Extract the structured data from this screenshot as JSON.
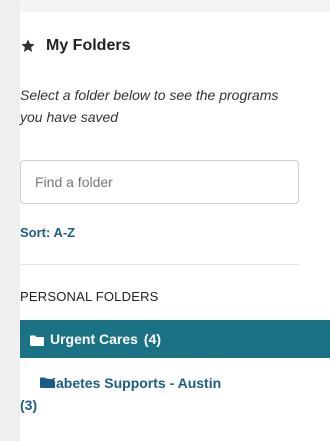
{
  "header": {
    "title": "My Folders",
    "icon": "star-icon"
  },
  "instructions": "Select a folder below to see the programs you have saved",
  "search": {
    "placeholder": "Find a folder",
    "value": ""
  },
  "sort": {
    "label": "Sort: A-Z"
  },
  "sections": [
    {
      "label": "PERSONAL FOLDERS",
      "folders": [
        {
          "name": "Urgent Cares",
          "count": "(4)",
          "active": true
        },
        {
          "name": "Diabetes Supports - Austin",
          "count": "(3)",
          "active": false
        }
      ]
    }
  ],
  "colors": {
    "accent": "#1b7284",
    "link": "#1b5c86"
  }
}
